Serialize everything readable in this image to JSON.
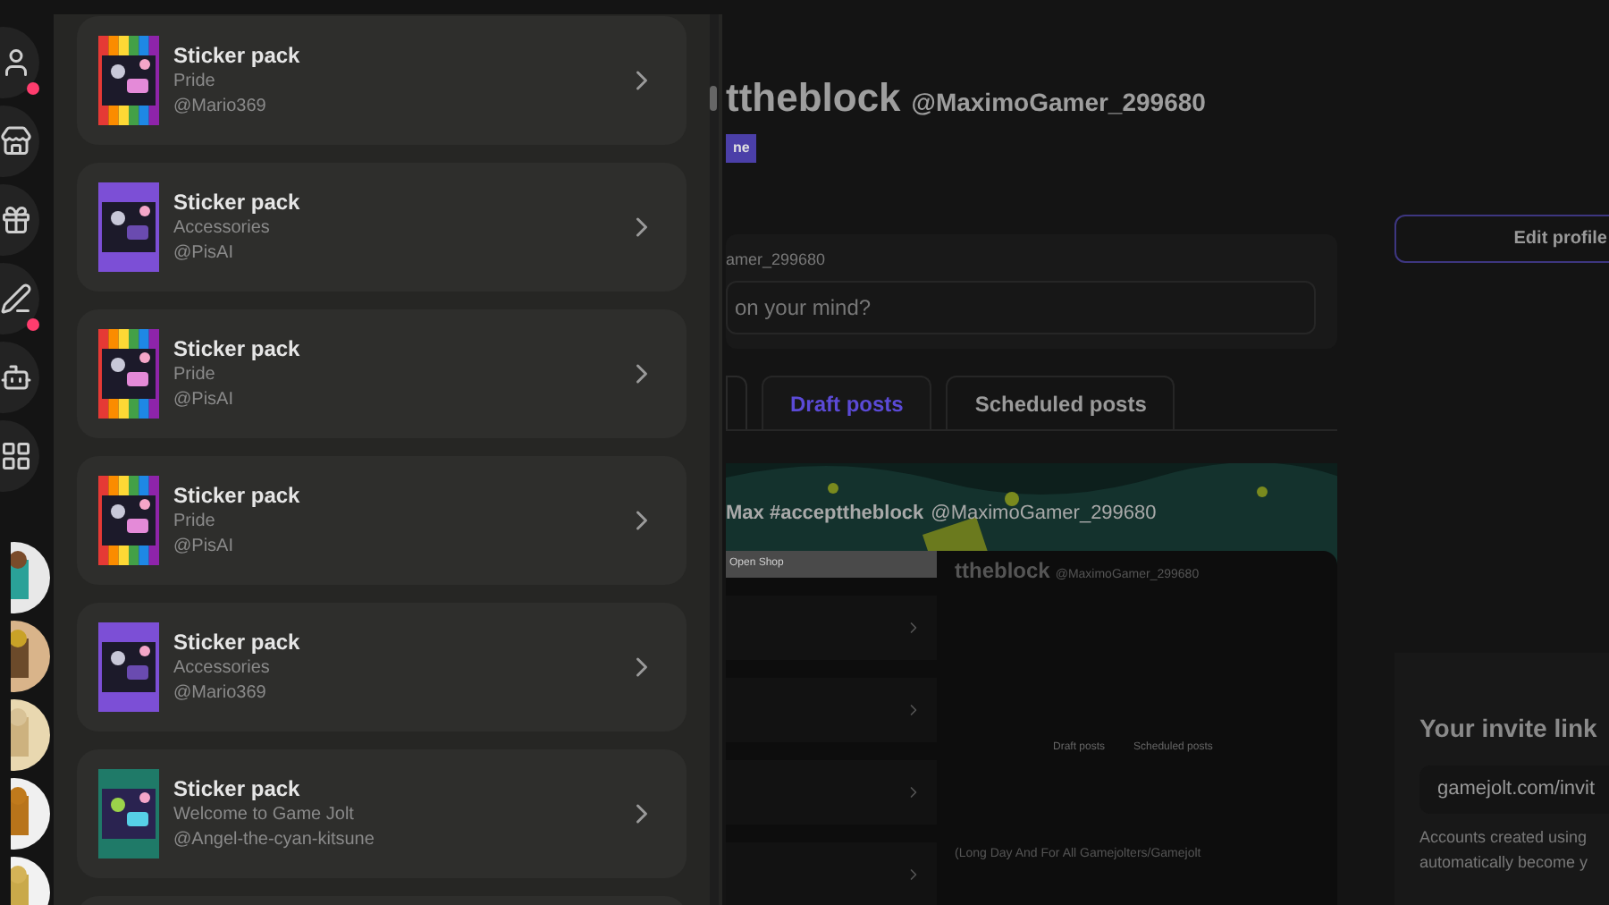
{
  "nav_rail": {
    "buttons": [
      {
        "notification": true
      },
      {
        "notification": false
      },
      {
        "notification": false
      },
      {
        "notification": true
      },
      {
        "notification": false
      },
      {
        "notification": false
      }
    ]
  },
  "profile": {
    "name": "ttheblock",
    "handle": "@MaximoGamer_299680",
    "badge": "ne"
  },
  "composer": {
    "user": "amer_299680",
    "placeholder": "on your mind?"
  },
  "tabs": [
    {
      "label": "Draft posts",
      "selected": true
    },
    {
      "label": "Scheduled posts",
      "selected": false
    }
  ],
  "post": {
    "author": "Max #accepttheblock",
    "handle": "@MaximoGamer_299680",
    "screenshot": {
      "shop_button": "Open Shop",
      "name": "ttheblock",
      "handle": "@MaximoGamer_299680",
      "tabs": [
        "Draft posts",
        "Scheduled posts"
      ],
      "post_text": "(Long Day And For All Gamejolters/Gamejolt"
    }
  },
  "edit_profile_button": "Edit profile",
  "invite": {
    "title": "Your invite link",
    "link": "gamejolt.com/invit",
    "note": [
      "Accounts created using",
      "automatically become y"
    ]
  },
  "sticker_list": {
    "items": [
      {
        "kind": "rainbow",
        "title": "Sticker pack",
        "subtitle": "Pride",
        "owner": "@Mario369"
      },
      {
        "kind": "purple",
        "title": "Sticker pack",
        "subtitle": "Accessories",
        "owner": "@PisAI"
      },
      {
        "kind": "rainbow",
        "title": "Sticker pack",
        "subtitle": "Pride",
        "owner": "@PisAI"
      },
      {
        "kind": "rainbow",
        "title": "Sticker pack",
        "subtitle": "Pride",
        "owner": "@PisAI"
      },
      {
        "kind": "purple",
        "title": "Sticker pack",
        "subtitle": "Accessories",
        "owner": "@Mario369"
      },
      {
        "kind": "teal",
        "title": "Sticker pack",
        "subtitle": "Welcome to Game Jolt",
        "owner": "@Angel-the-cyan-kitsune"
      }
    ]
  }
}
